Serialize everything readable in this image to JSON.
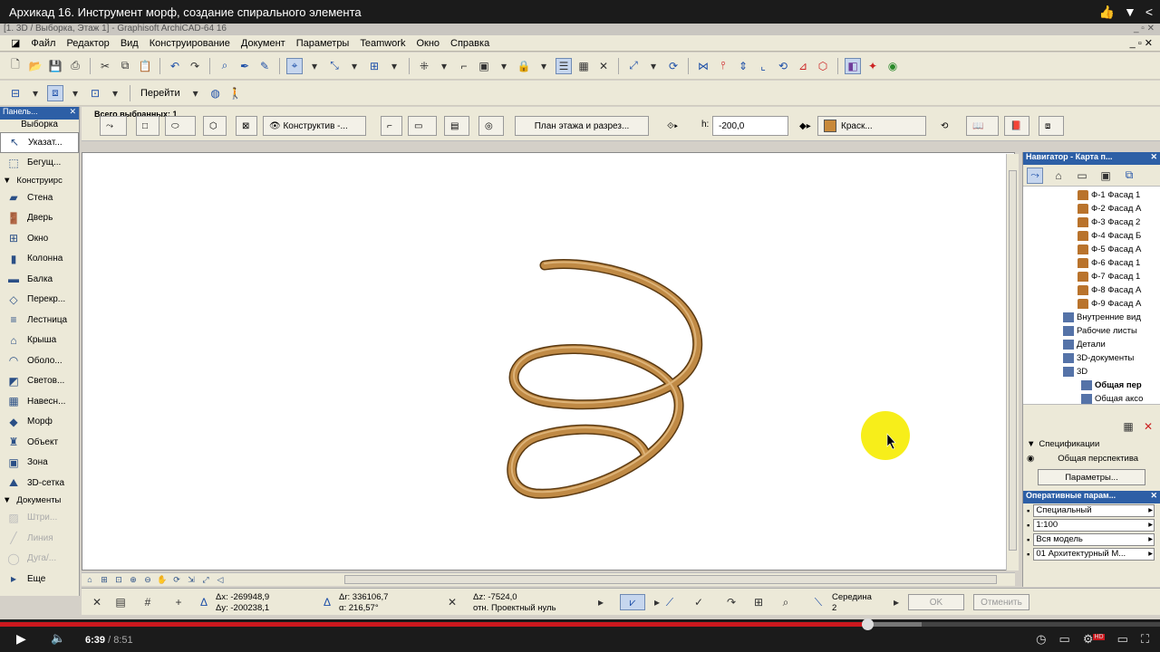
{
  "video": {
    "title": "Архикад 16. Инструмент морф, создание спирального элемента",
    "current_time": "6:39",
    "duration": "8:51",
    "progress": 0.748,
    "quality_badge": "HD"
  },
  "window": {
    "title": "[1. 3D / Выборка, Этаж 1] - Graphisoft ArchiCAD-64 16"
  },
  "menu": [
    "Файл",
    "Редактор",
    "Вид",
    "Конструирование",
    "Документ",
    "Параметры",
    "Teamwork",
    "Окно",
    "Справка"
  ],
  "toolbar2": {
    "goto": "Перейти"
  },
  "infobox": {
    "selected_label": "Всего выбранных: 1",
    "layer": "Конструктив -...",
    "view_button": "План этажа и разрез...",
    "h_label": "h:",
    "h_value": "-200,0",
    "material": "Краск...",
    "material_color": "#c8893a"
  },
  "left_panel": {
    "header": "Панель...",
    "tab": "Выборка",
    "tools": [
      {
        "label": "Указат...",
        "icon": "pointer-icon",
        "active": true
      },
      {
        "label": "Бегущ...",
        "icon": "marquee-icon"
      },
      {
        "label": "Конструирс",
        "group": true
      },
      {
        "label": "Стена",
        "icon": "wall-icon"
      },
      {
        "label": "Дверь",
        "icon": "door-icon"
      },
      {
        "label": "Окно",
        "icon": "window-icon"
      },
      {
        "label": "Колонна",
        "icon": "column-icon"
      },
      {
        "label": "Балка",
        "icon": "beam-icon"
      },
      {
        "label": "Перекр...",
        "icon": "slab-icon"
      },
      {
        "label": "Лестница",
        "icon": "stair-icon"
      },
      {
        "label": "Крыша",
        "icon": "roof-icon"
      },
      {
        "label": "Оболо...",
        "icon": "shell-icon"
      },
      {
        "label": "Светов...",
        "icon": "skylight-icon"
      },
      {
        "label": "Навесн...",
        "icon": "curtain-wall-icon"
      },
      {
        "label": "Морф",
        "icon": "morph-icon"
      },
      {
        "label": "Объект",
        "icon": "object-icon"
      },
      {
        "label": "Зона",
        "icon": "zone-icon"
      },
      {
        "label": "3D-сетка",
        "icon": "mesh-icon"
      },
      {
        "label": "Документы",
        "group": true
      },
      {
        "label": "Штри...",
        "icon": "hatch-icon",
        "dim": true
      },
      {
        "label": "Линия",
        "icon": "line-icon",
        "dim": true
      },
      {
        "label": "Дуга/...",
        "icon": "arc-icon",
        "dim": true
      },
      {
        "label": "Еще",
        "icon": "more-icon"
      }
    ]
  },
  "navigator": {
    "header": "Навигатор - Карта п...",
    "items": [
      {
        "label": "Ф-1 Фасад 1",
        "type": "elev"
      },
      {
        "label": "Ф-2 Фасад А",
        "type": "elev"
      },
      {
        "label": "Ф-3 Фасад 2",
        "type": "elev"
      },
      {
        "label": "Ф-4 Фасад Б",
        "type": "elev"
      },
      {
        "label": "Ф-5 Фасад А",
        "type": "elev"
      },
      {
        "label": "Ф-6 Фасад 1",
        "type": "elev"
      },
      {
        "label": "Ф-7 Фасад 1",
        "type": "elev"
      },
      {
        "label": "Ф-8 Фасад А",
        "type": "elev"
      },
      {
        "label": "Ф-9 Фасад А",
        "type": "elev"
      },
      {
        "label": "Внутренние вид",
        "type": "folder"
      },
      {
        "label": "Рабочие листы",
        "type": "folder"
      },
      {
        "label": "Детали",
        "type": "folder"
      },
      {
        "label": "3D-документы",
        "type": "folder"
      },
      {
        "label": "3D",
        "type": "folder"
      },
      {
        "label": "Общая пер",
        "type": "view",
        "bold": true
      },
      {
        "label": "Общая аксо",
        "type": "view"
      }
    ],
    "specs_label": "Спецификации",
    "view_name": "Общая перспектива",
    "params_button": "Параметры..."
  },
  "quick_options": {
    "header": "Оперативные парам...",
    "rows": [
      "Специальный",
      "1:100",
      "Вся модель",
      "01 Архитектурный М..."
    ]
  },
  "coords": {
    "dx": "Δx: -269948,9",
    "dy": "Δy: -200238,1",
    "dr": "Δr: 336106,7",
    "angle": "α: 216,57°",
    "dz": "Δz: -7524,0",
    "ref": "отн. Проектный нуль",
    "snap_label": "Середина",
    "snap_value": "2",
    "ok": "OK",
    "cancel": "Отменить"
  }
}
